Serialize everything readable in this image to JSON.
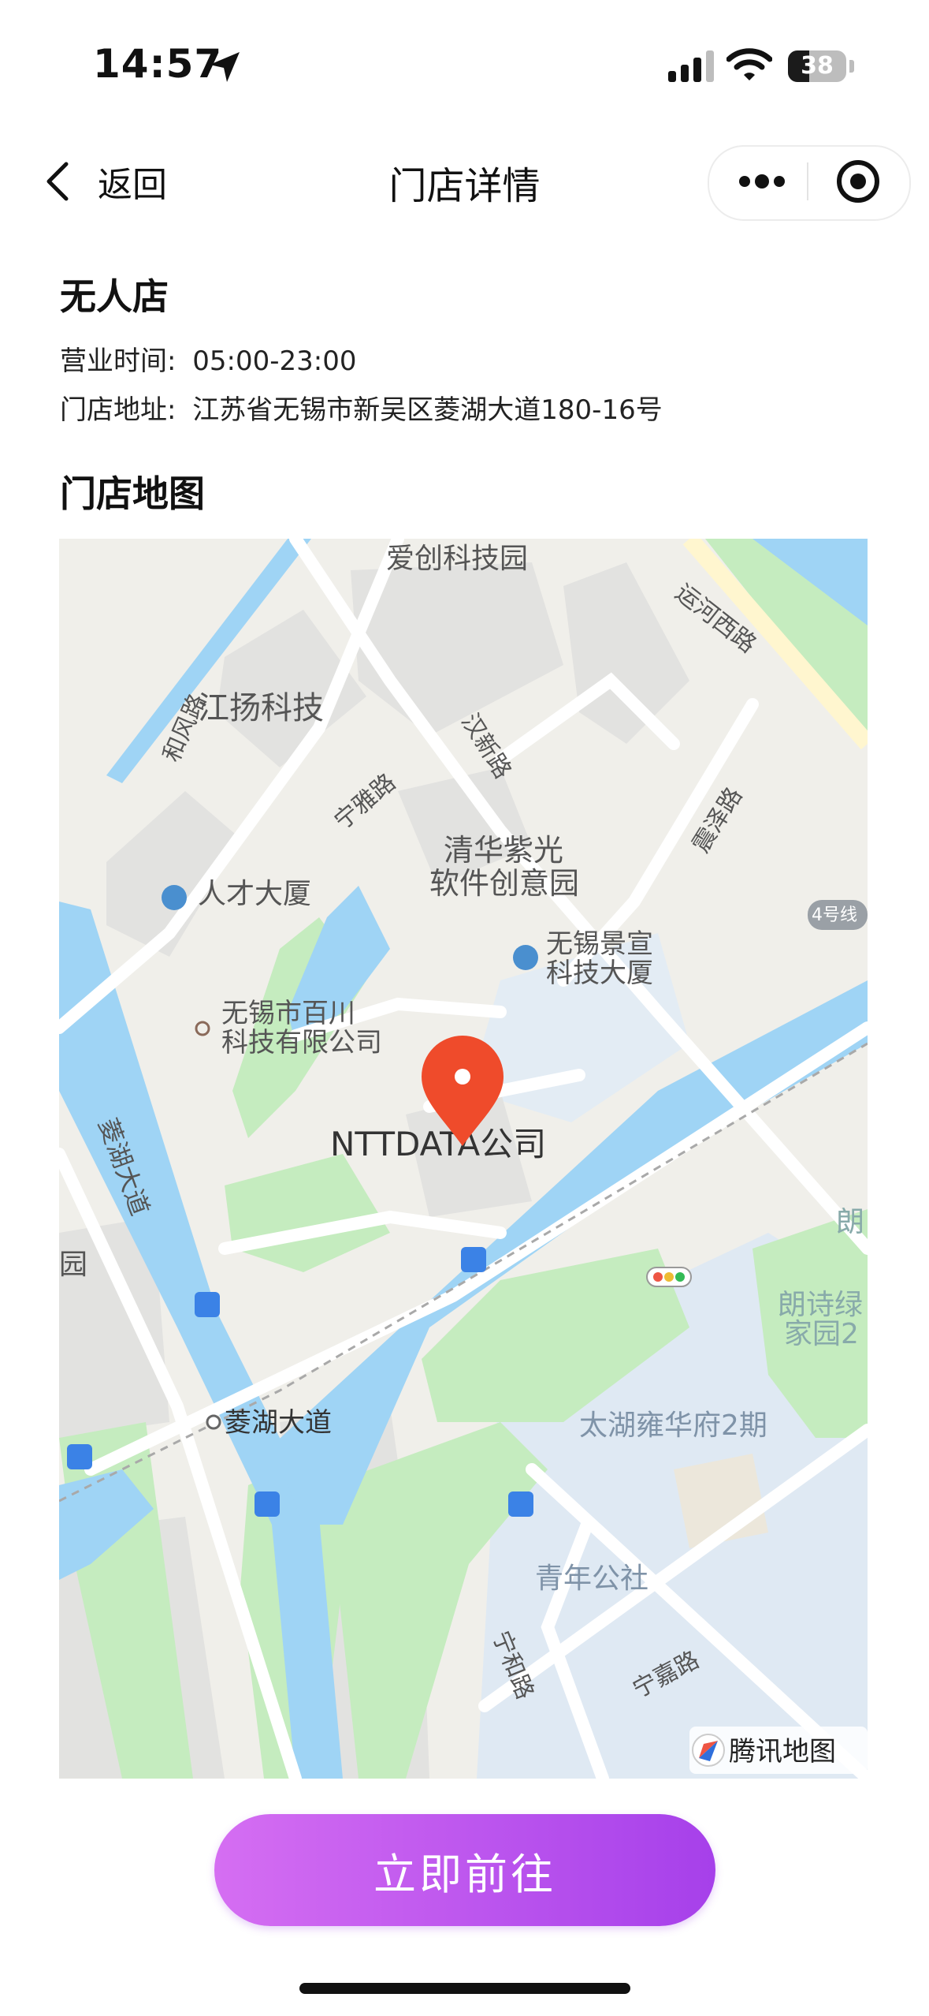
{
  "status_bar": {
    "time": "14:57",
    "battery": "38"
  },
  "nav": {
    "back_label": "返回",
    "title": "门店详情"
  },
  "store": {
    "name": "无人店",
    "hours_label": "营业时间:",
    "hours_value": "05:00-23:00",
    "address_label": "门店地址:",
    "address_value": "江苏省无锡市新吴区菱湖大道180-16号"
  },
  "map_section": {
    "heading": "门店地图"
  },
  "map": {
    "labels": {
      "aichuang": "爱创科技园",
      "yunhe": "运河西路",
      "hefeng": "和风路",
      "jiangyang": "江扬科技",
      "hanxin": "汉新路",
      "ningya": "宁雅路",
      "zhenze": "震泽路",
      "qinghua1": "清华紫光",
      "qinghua2": "软件创意园",
      "rencai": "人才大厦",
      "metro4": "4号线",
      "jingxuan1": "无锡景宣",
      "jingxuan2": "科技大厦",
      "baichuan1": "无锡市百川",
      "baichuan2": "科技有限公司",
      "linghu_road": "菱湖大道",
      "nttdata": "NTTDATA公司",
      "yuan": "园",
      "lang": "朗",
      "langshi1": "朗诗绿",
      "langshi2": "家园2",
      "linghu_station": "菱湖大道",
      "taihu": "太湖雍华府2期",
      "qingnian": "青年公社",
      "ninghe": "宁和路",
      "ningjia": "宁嘉路",
      "watermark": "腾讯地图"
    },
    "colors": {
      "water": "#9fd4f5",
      "green": "#c5ecbf",
      "pin": "#ef4b2b"
    }
  },
  "action": {
    "go_label": "立即前往"
  },
  "accent_colors": {
    "button_start": "#d56ef2",
    "button_end": "#a640ea"
  }
}
